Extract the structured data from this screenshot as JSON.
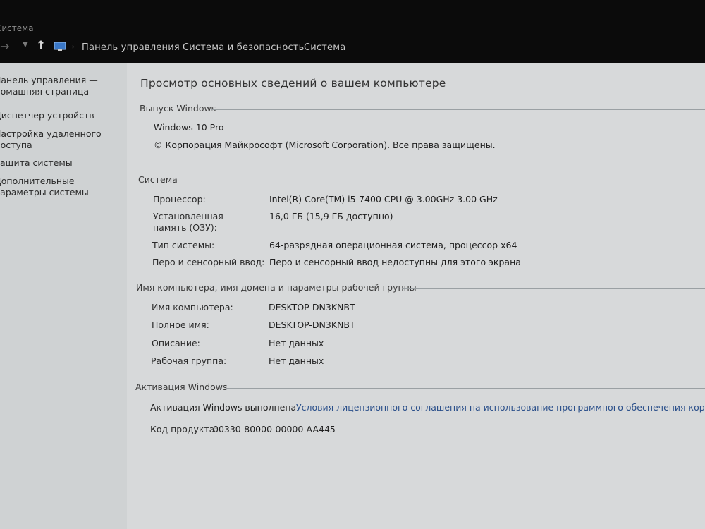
{
  "window": {
    "title": "Система"
  },
  "breadcrumb": {
    "items": [
      "Панель управления",
      "Система и безопасность",
      "Система"
    ]
  },
  "sidebar": {
    "items": [
      {
        "label": "Панель управления — домашняя страница"
      },
      {
        "label": "Диспетчер устройств"
      },
      {
        "label": "Настройка удаленного доступа"
      },
      {
        "label": "Защита системы"
      },
      {
        "label": "Дополнительные параметры системы"
      }
    ]
  },
  "main": {
    "title": "Просмотр основных сведений о вашем компьютере",
    "windows_edition": {
      "heading": "Выпуск Windows",
      "edition": "Windows 10 Pro",
      "copyright": "© Корпорация Майкрософт (Microsoft Corporation). Все права защищены."
    },
    "system": {
      "heading": "Система",
      "rows": [
        {
          "label": "Процессор:",
          "value": "Intel(R) Core(TM) i5-7400 CPU @ 3.00GHz   3.00 GHz"
        },
        {
          "label": "Установленная память (ОЗУ):",
          "value": "16,0 ГБ (15,9 ГБ доступно)"
        },
        {
          "label": "Тип системы:",
          "value": "64-разрядная операционная система, процессор x64"
        },
        {
          "label": "Перо и сенсорный ввод:",
          "value": "Перо и сенсорный ввод недоступны для этого экрана"
        }
      ]
    },
    "computer": {
      "heading": "Имя компьютера, имя домена и параметры рабочей группы",
      "rows": [
        {
          "label": "Имя компьютера:",
          "value": "DESKTOP-DN3KNBT"
        },
        {
          "label": "Полное имя:",
          "value": "DESKTOP-DN3KNBT"
        },
        {
          "label": "Описание:",
          "value": "Нет данных"
        },
        {
          "label": "Рабочая группа:",
          "value": "Нет данных"
        }
      ]
    },
    "activation": {
      "heading": "Активация Windows",
      "status": "Активация Windows выполнена",
      "license_link": "Условия лицензионного соглашения на использование программного обеспечения корпор",
      "product_key_label": "Код продукта:",
      "product_key": "00330-80000-00000-AA445"
    }
  },
  "colors": {
    "link": "#2a4f8a",
    "titlebar": "#0b0b0b",
    "background": "#d7d9da"
  }
}
